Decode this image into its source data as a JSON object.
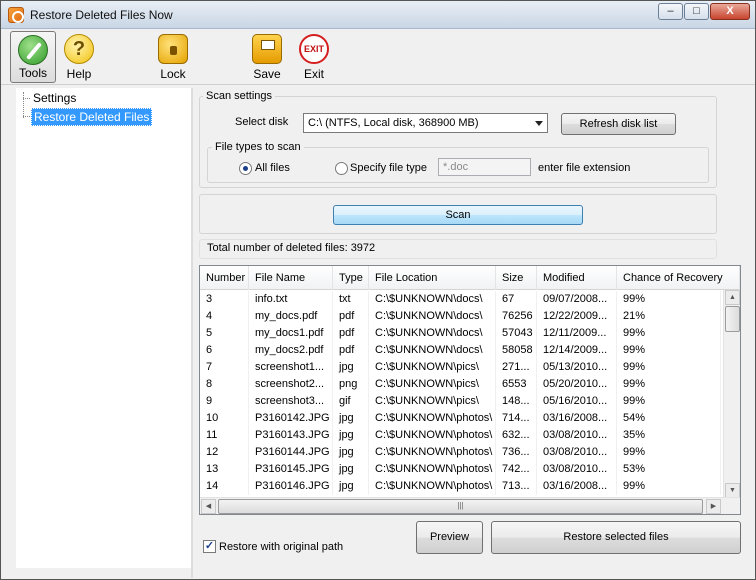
{
  "window": {
    "title": "Restore Deleted Files Now",
    "controls": {
      "minimize": "–",
      "maximize": "□",
      "close": "X"
    }
  },
  "toolbar": {
    "items": [
      {
        "label": "Tools",
        "icon": "tools-icon"
      },
      {
        "label": "Help",
        "icon": "help-icon"
      },
      {
        "label": "Lock",
        "icon": "lock-icon"
      },
      {
        "label": "Save",
        "icon": "save-icon"
      },
      {
        "label": "Exit",
        "icon": "exit-icon",
        "icon_text": "EXIT"
      }
    ],
    "help_glyph": "?"
  },
  "tree": {
    "items": [
      "Settings",
      "Restore Deleted Files"
    ],
    "selected": "Restore Deleted Files"
  },
  "scan_settings": {
    "title": "Scan settings",
    "select_disk_label": "Select disk",
    "disk_value": "C:\\  (NTFS, Local disk, 368900 MB)",
    "refresh_button": "Refresh disk list",
    "file_types": {
      "title": "File types to scan",
      "all_files_label": "All files",
      "specify_label": "Specify file type",
      "extension_placeholder": "*.doc",
      "extension_hint": "enter file extension",
      "selected": "All files"
    }
  },
  "scan_button": "Scan",
  "total_label": "Total number of deleted files: 3972",
  "table": {
    "columns": [
      "Number",
      "File Name",
      "Type",
      "File Location",
      "Size",
      "Modified",
      "Chance of Recovery"
    ],
    "rows": [
      [
        "3",
        "info.txt",
        "txt",
        "C:\\$UNKNOWN\\docs\\",
        "67",
        "09/07/2008...",
        "99%"
      ],
      [
        "4",
        "my_docs.pdf",
        "pdf",
        "C:\\$UNKNOWN\\docs\\",
        "76256",
        "12/22/2009...",
        "21%"
      ],
      [
        "5",
        "my_docs1.pdf",
        "pdf",
        "C:\\$UNKNOWN\\docs\\",
        "57043",
        "12/11/2009...",
        "99%"
      ],
      [
        "6",
        "my_docs2.pdf",
        "pdf",
        "C:\\$UNKNOWN\\docs\\",
        "58058",
        "12/14/2009...",
        "99%"
      ],
      [
        "7",
        "screenshot1...",
        "jpg",
        "C:\\$UNKNOWN\\pics\\",
        "271...",
        "05/13/2010...",
        "99%"
      ],
      [
        "8",
        "screenshot2...",
        "png",
        "C:\\$UNKNOWN\\pics\\",
        "6553",
        "05/20/2010...",
        "99%"
      ],
      [
        "9",
        "screenshot3...",
        "gif",
        "C:\\$UNKNOWN\\pics\\",
        "148...",
        "05/16/2010...",
        "99%"
      ],
      [
        "10",
        "P3160142.JPG",
        "jpg",
        "C:\\$UNKNOWN\\photos\\",
        "714...",
        "03/16/2008...",
        "54%"
      ],
      [
        "11",
        "P3160143.JPG",
        "jpg",
        "C:\\$UNKNOWN\\photos\\",
        "632...",
        "03/08/2010...",
        "35%"
      ],
      [
        "12",
        "P3160144.JPG",
        "jpg",
        "C:\\$UNKNOWN\\photos\\",
        "736...",
        "03/08/2010...",
        "99%"
      ],
      [
        "13",
        "P3160145.JPG",
        "jpg",
        "C:\\$UNKNOWN\\photos\\",
        "742...",
        "03/08/2010...",
        "53%"
      ],
      [
        "14",
        "P3160146.JPG",
        "jpg",
        "C:\\$UNKNOWN\\photos\\",
        "713...",
        "03/16/2008...",
        "99%"
      ]
    ]
  },
  "restore_original_path": {
    "label": "Restore with original path",
    "checked": true
  },
  "preview_button": "Preview",
  "restore_button": "Restore selected files"
}
